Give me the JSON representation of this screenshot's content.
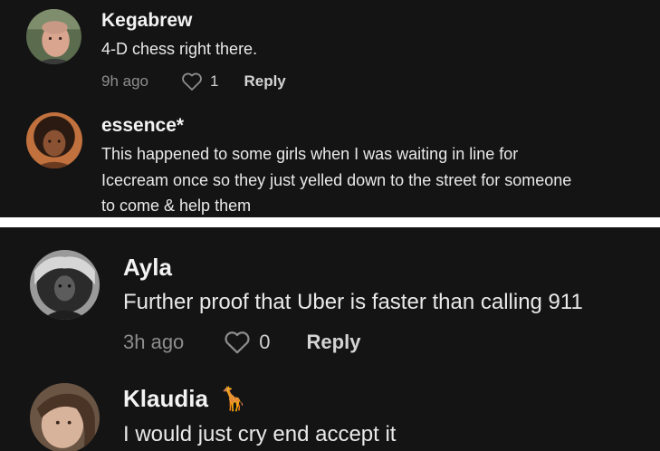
{
  "top_comments": [
    {
      "username": "Kegabrew",
      "text": "4-D chess right there.",
      "time": "9h ago",
      "likes": "1",
      "reply_label": "Reply",
      "avatar_icon": "person-avatar"
    },
    {
      "username": "essence*",
      "text_lines": [
        "This happened to some girls when I was waiting in line for",
        "Icecream once so they just yelled down to the street for someone",
        "to come & help them"
      ],
      "avatar_icon": "person-avatar"
    }
  ],
  "bottom_comments": [
    {
      "username": "Ayla",
      "text": "Further proof that Uber is faster than calling 911",
      "time": "3h ago",
      "likes": "0",
      "reply_label": "Reply",
      "avatar_icon": "person-avatar"
    },
    {
      "username": "Klaudia",
      "username_emoji": "🦒",
      "text": "I would just cry end accept it",
      "avatar_icon": "person-avatar"
    }
  ],
  "colors": {
    "background": "#141414",
    "username": "#f3f3f3",
    "text": "#e9e9e9",
    "meta": "#8d8d8d"
  }
}
